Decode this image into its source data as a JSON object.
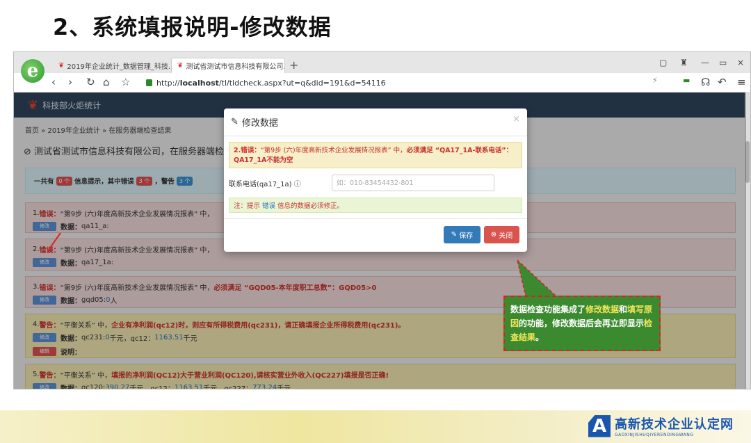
{
  "slide": {
    "title": "2、系统填报说明-修改数据",
    "brand_cn": "高新技术企业认定网",
    "brand_en": "GAOXINJISHUQIYERENDINGWANG",
    "brand_logo": "A"
  },
  "browser": {
    "tabs": [
      {
        "label": "2019年企业统计_数据管理_科技...",
        "active": false
      },
      {
        "label": "测试省测试市信息科技有限公司...",
        "active": true
      }
    ],
    "url_prefix": "http://",
    "url_host": "localhost",
    "url_path": "/tl/tldcheck.aspx?ut=q&did=191&d=54116"
  },
  "app": {
    "title": "科技部火炬统计",
    "breadcrumb": "首页 » 2019年企业统计 » 在服务器端检查结果",
    "company": "测试省测试市信息科技有限公司，在服务器端检",
    "summary": {
      "prefix": "一共有",
      "info_count": "0 个",
      "info_text": "信息提示，其中错误",
      "error_count": "3 个",
      "warn_text": "，警告",
      "warn_count": "3 个"
    },
    "items": [
      {
        "num": "1.",
        "level": "错误",
        "desc": "“第9步 (六)年度高新技术企业发展情况报表” 中，",
        "rule": "",
        "btn": "修改",
        "data_label": "数据：",
        "data": "qa11_a:"
      },
      {
        "num": "2.",
        "level": "错误",
        "desc": "“第9步 (六)年度高新技术企业发展情况报表” 中，",
        "rule": "",
        "btn": "修改",
        "data_label": "数据：",
        "data": "qa17_1a:"
      },
      {
        "num": "3.",
        "level": "错误",
        "desc": "“第9步 (六)年度高新技术企业发展情况报表” 中，",
        "rule": "必须满足 “GQD05-本年度职工总数”：GQD05>0",
        "btn": "修改",
        "data_label": "数据：",
        "data": "gqd05: ",
        "data_num": "0",
        "data_unit": " 人"
      },
      {
        "num": "4.",
        "level": "警告",
        "desc": "“平衡关系” 中，",
        "rule": "企业有净利润(qc12)时，则应有所得税费用(qc231)，请正确填报企业所得税费用(qc231)。",
        "btn": "修改",
        "data_label": "数据：",
        "data": "qc231: ",
        "data_num": "0",
        "data_unit": " 千元，qc12：",
        "data_num2": "1163.51",
        "data_unit2": " 千元",
        "btn2": "编辑",
        "note_label": "说明："
      },
      {
        "num": "5.",
        "level": "警告",
        "desc": "“平衡关系” 中，",
        "rule": "填报的净利润(QC12)大于营业利润(QC120),请核实营业外收入(QC227)填报是否正确!",
        "btn": "修改",
        "data_label": "数据：",
        "data": "qc120: ",
        "data_num": "390.27",
        "data_unit": " 千元，qc12：",
        "data_num2": "1163.51",
        "data_unit2": " 千元，qc227：",
        "data_num3": "773.24",
        "data_unit3": " 千元"
      }
    ]
  },
  "modal": {
    "title": "修改数据",
    "close": "×",
    "alert_prefix": "2.错误：",
    "alert_text": "“第9步 (六)年度高新技术企业发展情况报表” 中，",
    "alert_rule": "必须满足 “QA17_1A-联系电话”：QA17_1A不能为空",
    "field_label": "联系电话(qa17_1a)",
    "field_placeholder": "如：010-83454432-801",
    "note_prefix": "注：提示",
    "note_link": "错误",
    "note_suffix": "信息的数据必须修正。",
    "save_label": "保存",
    "close_label": "关闭"
  },
  "callout": {
    "t1": "数据检查功能集成了",
    "h1": "修改数据",
    "t2": "和",
    "h2": "填写原因",
    "t3": "的功能，修改数据后会再立即显示",
    "h3": "检查结果",
    "t4": "。"
  },
  "colors": {
    "header": "#30445c",
    "error": "#c9302c",
    "save": "#337ab7",
    "close": "#d9534f",
    "callout": "#3b8a2f"
  }
}
